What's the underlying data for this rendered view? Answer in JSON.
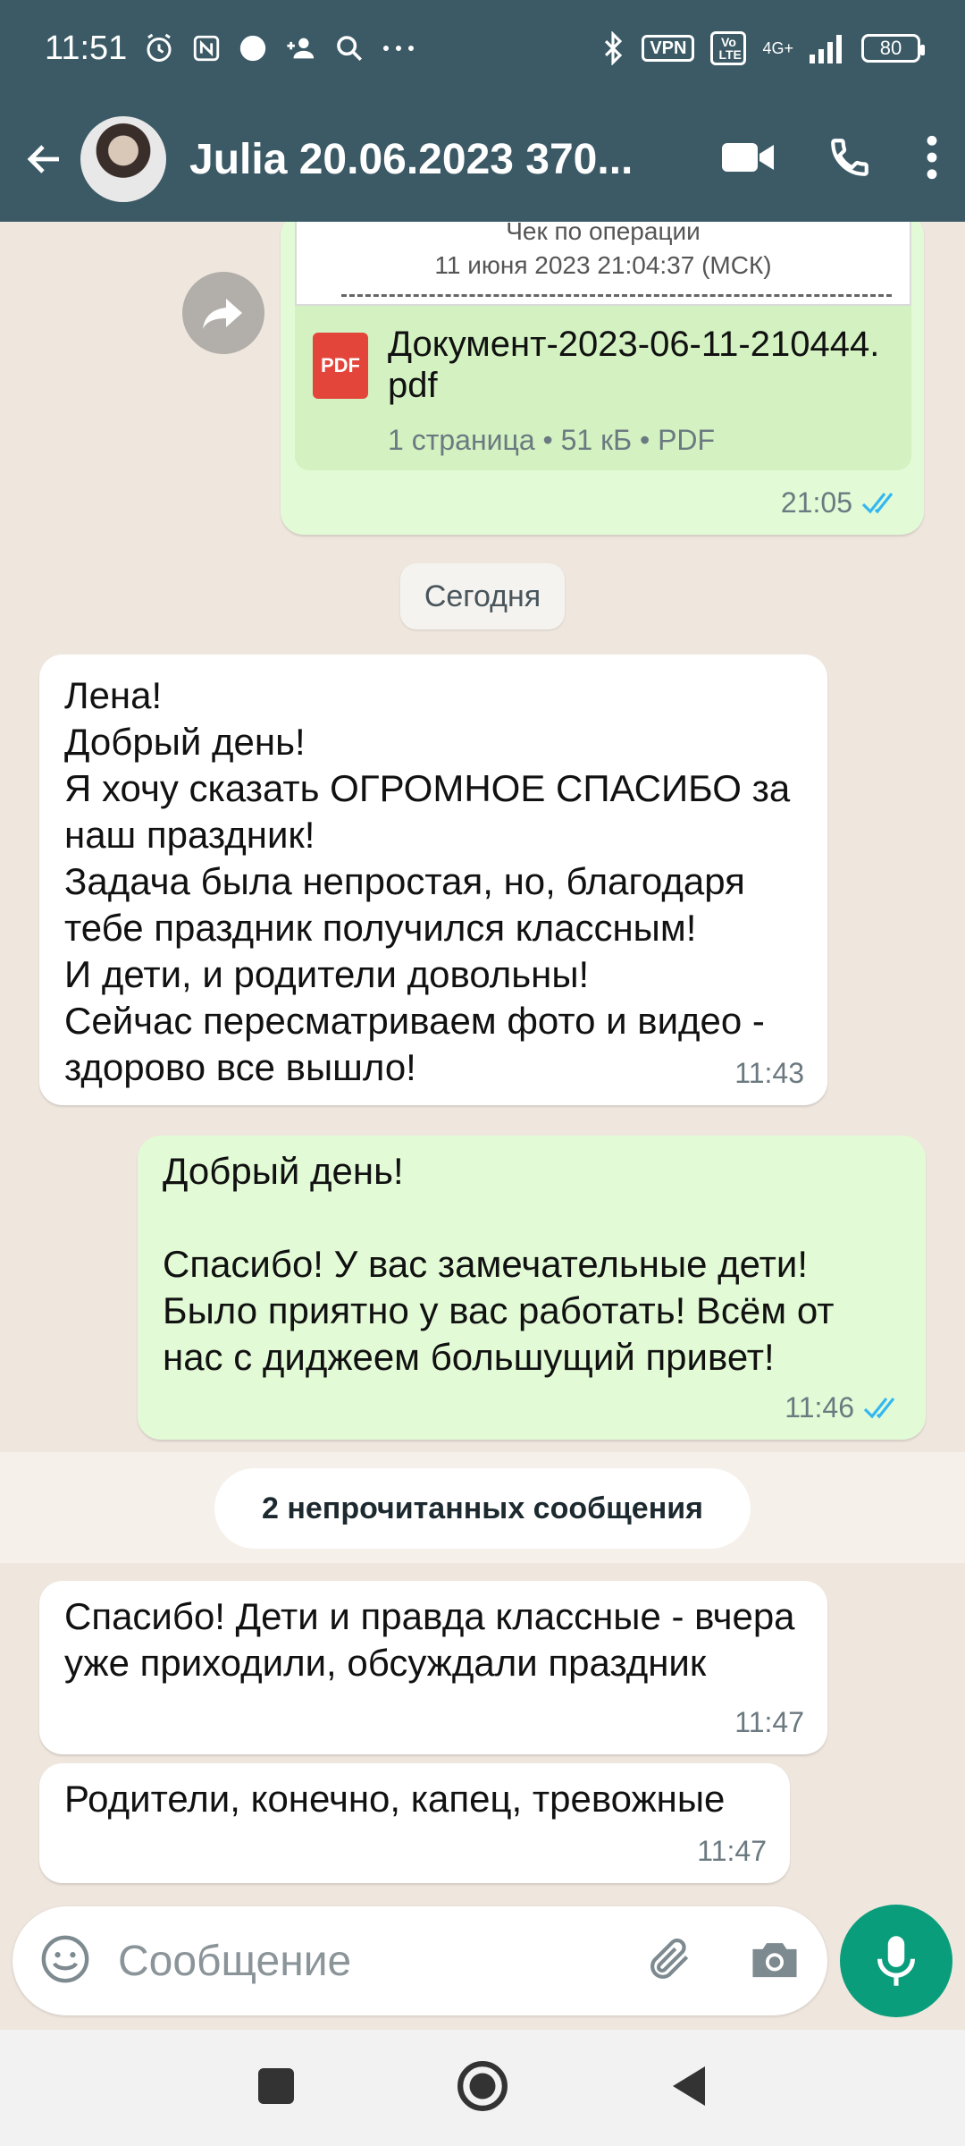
{
  "status": {
    "time": "11:51",
    "vpn": "VPN",
    "volte": "Vo LTE",
    "network": "4G+",
    "battery": "80"
  },
  "header": {
    "contact_name": "Julia 20.06.2023 370..."
  },
  "file_message": {
    "receipt_title": "Чек по операции",
    "receipt_date": "11 июня 2023 21:04:37 (МСК)",
    "pdf_label": "PDF",
    "file_name": "Документ-2023-06-11-210444.pdf",
    "file_meta": "1 страница • 51 кБ • PDF",
    "time": "21:05"
  },
  "day_separator": "Сегодня",
  "messages": [
    {
      "direction": "in",
      "text": "Лена!\nДобрый день!\nЯ хочу сказать ОГРОМНОЕ СПАСИБО за наш праздник!\nЗадача была непростая, но, благодаря тебе праздник получился классным!\nИ дети, и родители довольны!\nСейчас пересматриваем фото и видео - здорово все вышло!",
      "time": "11:43"
    },
    {
      "direction": "out",
      "text": "Добрый день!\n\nСпасибо! У вас замечательные дети! Было приятно у вас работать! Всём от нас с диджеем большущий привет!",
      "time": "11:46"
    },
    {
      "direction": "in",
      "text": "Спасибо! Дети и правда классные - вчера уже приходили, обсуждали праздник",
      "time": "11:47"
    },
    {
      "direction": "in",
      "text": "Родители, конечно, капец, тревожные",
      "time": "11:47"
    }
  ],
  "unread_label": "2 непрочитанных сообщения",
  "composer": {
    "placeholder": "Сообщение",
    "value": ""
  },
  "colors": {
    "header_bg": "#3b5a66",
    "outgoing_bubble": "#e2fbd6",
    "incoming_bubble": "#ffffff",
    "mic_button": "#0a9d7c",
    "read_ticks": "#34b7f1"
  }
}
